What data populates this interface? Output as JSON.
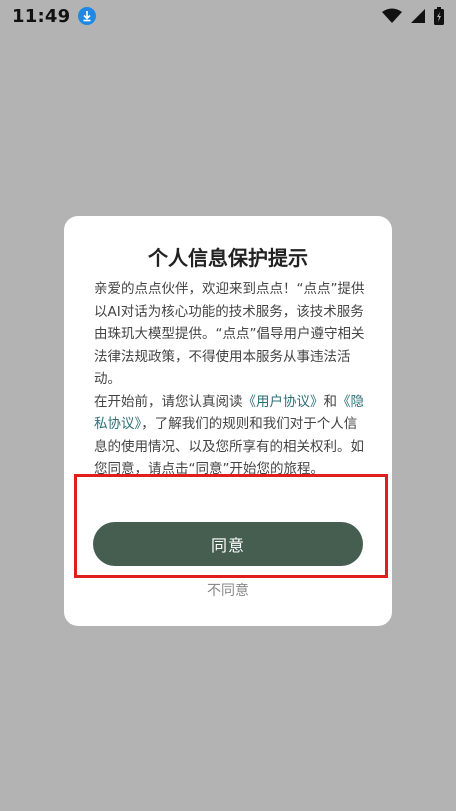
{
  "status_bar": {
    "time": "11:49",
    "icons": [
      "download-icon",
      "wifi-icon",
      "signal-icon",
      "battery-icon"
    ]
  },
  "dialog": {
    "title": "个人信息保护提示",
    "paragraph1": "亲爱的点点伙伴，欢迎来到点点！“点点”提供以AI对话为核心功能的技术服务，该技术服务由珠玑大模型提供。“点点”倡导用户遵守相关法律法规政策，不得使用本服务从事违法活动。",
    "p2_prefix": "在开始前，请您认真阅读",
    "user_agreement_link": "《用户协议》",
    "p2_and": "和",
    "privacy_link": "《隐私协议》",
    "p2_suffix": "，了解我们的规则和我们对于个人信息的使用情况、以及您所享有的相关权利。如您同意，请点击“同意”开始您的旅程。",
    "agree_label": "同意",
    "disagree_label": "不同意"
  },
  "colors": {
    "overlay": "#b3b3b3",
    "button": "#465e50",
    "link": "#2d6f78",
    "highlight": "#e11d1d"
  }
}
